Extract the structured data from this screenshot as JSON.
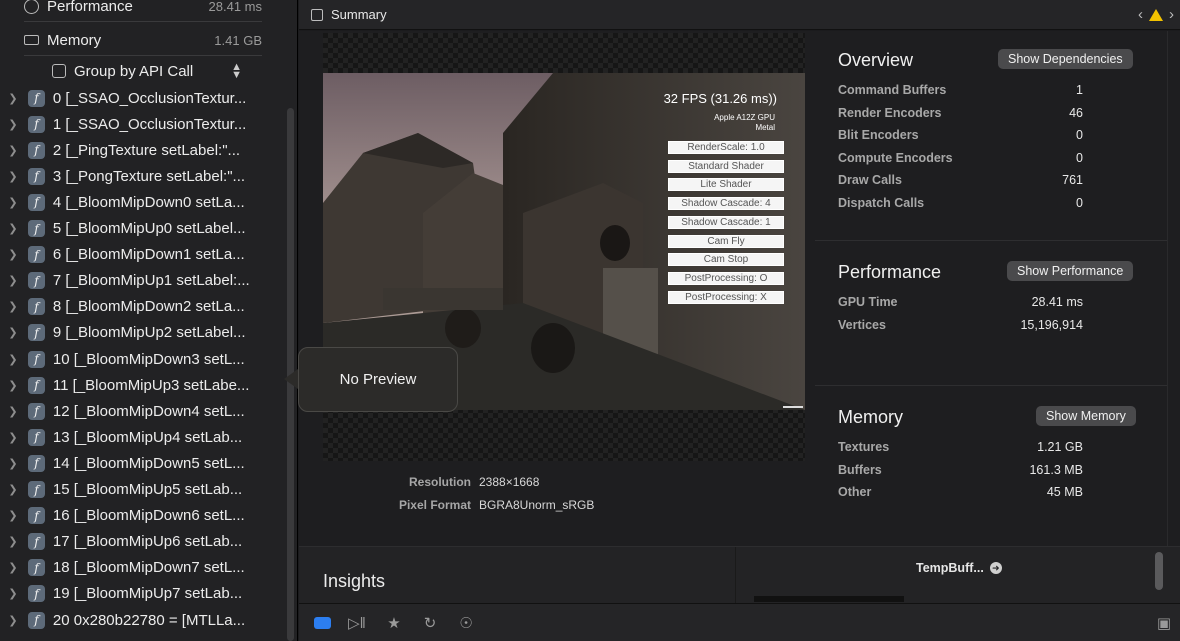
{
  "sidebar": {
    "top_items": [
      {
        "label": "Performance",
        "value": "28.41 ms",
        "icon": "clock-icon"
      },
      {
        "label": "Memory",
        "value": "1.41 GB",
        "icon": "memory-icon"
      }
    ],
    "group_by": "Group by API Call",
    "calls": [
      "0 [_SSAO_OcclusionTextur...",
      "1 [_SSAO_OcclusionTextur...",
      "2 [_PingTexture setLabel:\"...",
      "3 [_PongTexture setLabel:\"...",
      "4 [_BloomMipDown0 setLa...",
      "5 [_BloomMipUp0 setLabel...",
      "6 [_BloomMipDown1 setLa...",
      "7 [_BloomMipUp1 setLabel:...",
      "8 [_BloomMipDown2 setLa...",
      "9 [_BloomMipUp2 setLabel...",
      "10 [_BloomMipDown3 setL...",
      "11 [_BloomMipUp3 setLabe...",
      "12 [_BloomMipDown4 setL...",
      "13 [_BloomMipUp4 setLab...",
      "14 [_BloomMipDown5 setL...",
      "15 [_BloomMipUp5 setLab...",
      "16 [_BloomMipDown6 setL...",
      "17 [_BloomMipUp6 setLab...",
      "18 [_BloomMipDown7 setL...",
      "19 [_BloomMipUp7 setLab...",
      "20 0x280b22780 = [MTLLa..."
    ]
  },
  "popover": {
    "text": "No Preview"
  },
  "header": {
    "title": "Summary"
  },
  "preview": {
    "fps": "32 FPS (31.26 ms))",
    "gpu_line1": "Apple A12Z GPU",
    "gpu_line2": "Metal",
    "buttons": [
      "RenderScale: 1.0",
      "Standard Shader",
      "Lite Shader",
      "Shadow Cascade: 4",
      "Shadow Cascade: 1",
      "Cam Fly",
      "Cam Stop",
      "PostProcessing: O",
      "PostProcessing: X"
    ],
    "resolution_label": "Resolution",
    "resolution_value": "2388×1668",
    "pixel_format_label": "Pixel Format",
    "pixel_format_value": "BGRA8Unorm_sRGB"
  },
  "overview": {
    "title": "Overview",
    "button": "Show Dependencies",
    "stats": [
      {
        "label": "Command Buffers",
        "value": "1"
      },
      {
        "label": "Render Encoders",
        "value": "46"
      },
      {
        "label": "Blit Encoders",
        "value": "0"
      },
      {
        "label": "Compute Encoders",
        "value": "0"
      },
      {
        "label": "Draw Calls",
        "value": "761"
      },
      {
        "label": "Dispatch Calls",
        "value": "0"
      }
    ]
  },
  "performance": {
    "title": "Performance",
    "button": "Show Performance",
    "stats": [
      {
        "label": "GPU Time",
        "value": "28.41 ms"
      },
      {
        "label": "Vertices",
        "value": "15,196,914"
      }
    ]
  },
  "memory": {
    "title": "Memory",
    "button": "Show Memory",
    "stats": [
      {
        "label": "Textures",
        "value": "1.21 GB"
      },
      {
        "label": "Buffers",
        "value": "161.3 MB"
      },
      {
        "label": "Other",
        "value": "45 MB"
      }
    ]
  },
  "insights": {
    "title": "Insights",
    "item": "TempBuff..."
  },
  "colors": {
    "accent": "#2c7ef0",
    "warning": "#f2c200",
    "background": "#1b1b1d"
  }
}
